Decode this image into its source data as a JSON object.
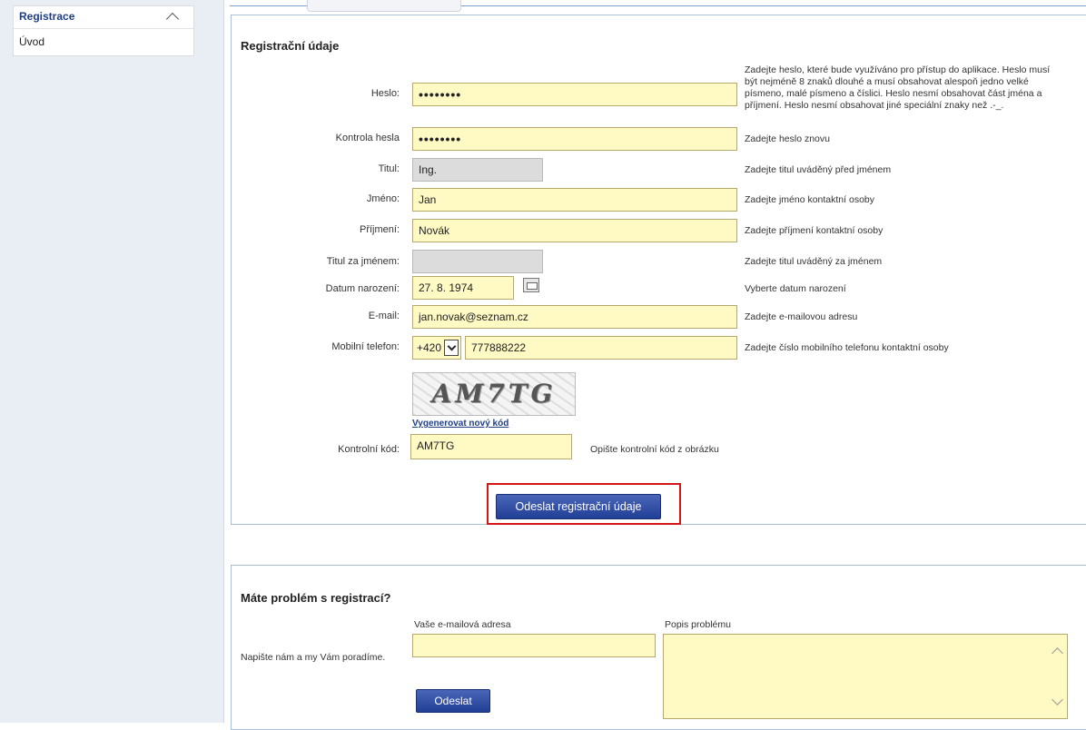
{
  "sidebar": {
    "header": "Registrace",
    "items": [
      {
        "label": "Úvod"
      }
    ]
  },
  "registration": {
    "title": "Registrační údaje",
    "password": {
      "label": "Heslo:",
      "value": "••••••••",
      "hint": "Zadejte heslo, které bude využíváno pro přístup do aplikace. Heslo musí být nejméně 8 znaků dlouhé a musí obsahovat alespoň jedno velké písmeno, malé písmeno a číslici. Heslo nesmí obsahovat část jména a příjmení. Heslo nesmí obsahovat jiné speciální znaky než .-_."
    },
    "password_check": {
      "label": "Kontrola hesla",
      "value": "••••••••",
      "hint": "Zadejte heslo znovu"
    },
    "title_before": {
      "label": "Titul:",
      "value": "Ing.",
      "hint": "Zadejte titul uváděný před jménem"
    },
    "first_name": {
      "label": "Jméno:",
      "value": "Jan",
      "hint": "Zadejte jméno kontaktní osoby"
    },
    "last_name": {
      "label": "Příjmení:",
      "value": "Novák",
      "hint": "Zadejte příjmení kontaktní osoby"
    },
    "title_after": {
      "label": "Titul za jménem:",
      "value": "",
      "hint": "Zadejte titul uváděný za jménem"
    },
    "birth_date": {
      "label": "Datum narození:",
      "value": "27. 8. 1974",
      "hint": "Vyberte datum narození"
    },
    "email": {
      "label": "E-mail:",
      "value": "jan.novak@seznam.cz",
      "hint": "Zadejte e-mailovou adresu"
    },
    "mobile": {
      "label": "Mobilní telefon:",
      "prefix": "+420",
      "value": "777888222",
      "hint": "Zadejte číslo mobilního telefonu kontaktní osoby"
    },
    "captcha": {
      "image_text": "AM7TG",
      "regenerate_link": "Vygenerovat nový kód"
    },
    "control_code": {
      "label": "Kontrolní kód:",
      "value": "AM7TG",
      "hint": "Opište kontrolní kód z obrázku"
    },
    "submit_label": "Odeslat registrační údaje"
  },
  "problem": {
    "title": "Máte problém s registrací?",
    "note": "Napište nám a my Vám poradíme.",
    "email_label": "Vaše e-mailová adresa",
    "email_value": "",
    "desc_label": "Popis problému",
    "desc_value": "",
    "send_label": "Odeslat"
  },
  "colors": {
    "accent": "#213f96",
    "field_bg": "#fff9c4",
    "highlight": "#d41515"
  }
}
